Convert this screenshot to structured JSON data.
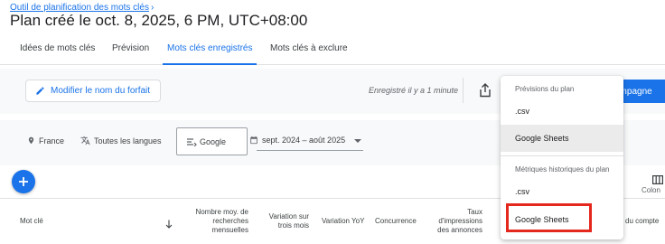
{
  "breadcrumb": {
    "label": "Outil de planification des mots clés",
    "chevron": "›"
  },
  "page_title": "Plan créé le oct. 8, 2025, 6 PM, UTC+08:00",
  "tabs": [
    {
      "label": "Idées de mots clés",
      "active": false
    },
    {
      "label": "Prévision",
      "active": false
    },
    {
      "label": "Mots clés enregistrés",
      "active": true
    },
    {
      "label": "Mots clés à exclure",
      "active": false
    }
  ],
  "toolbar": {
    "rename_label": "Modifier le nom du forfait",
    "saved_status": "Enregistré il y a 1 minute",
    "campaign_label": "ampagne"
  },
  "filters": {
    "location": "France",
    "language": "Toutes les langues",
    "network": "Google",
    "date_range": "sept. 2024 – août 2025"
  },
  "columns_label": "Colon",
  "table": {
    "headers": [
      "Mot clé",
      "Nombre moy. de recherches mensuelles",
      "Variation sur trois mois",
      "Variation YoY",
      "Concurrence",
      "Taux d'impressions des annonces",
      "du compte"
    ]
  },
  "download_menu": {
    "section1_title": "Prévisions du plan",
    "section1_items": [
      ".csv",
      "Google Sheets"
    ],
    "section2_title": "Métriques historiques du plan",
    "section2_items": [
      ".csv",
      "Google Sheets"
    ]
  },
  "colors": {
    "accent": "#1a73e8",
    "highlight": "#e5281e",
    "text": "#202124",
    "muted": "#5f6368"
  },
  "icons": [
    "pencil-icon",
    "share-icon",
    "location-pin-icon",
    "translate-icon",
    "network-icon",
    "calendar-icon",
    "add-icon",
    "columns-icon",
    "sort-arrow-icon"
  ]
}
